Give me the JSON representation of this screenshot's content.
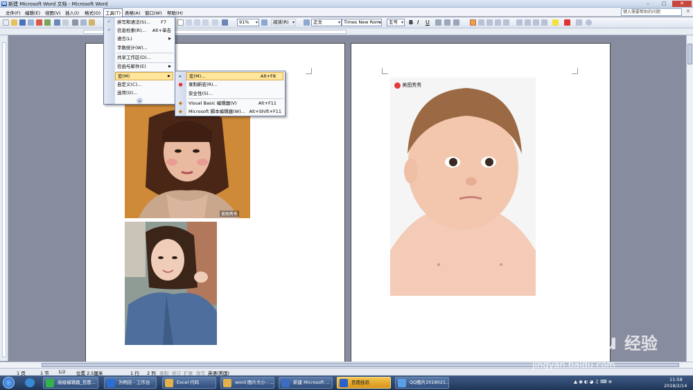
{
  "window": {
    "title": "新建 Microsoft Word 文档 - Microsoft Word"
  },
  "menubar": {
    "items": [
      "文件(F)",
      "编辑(E)",
      "视图(V)",
      "插入(I)",
      "格式(O)",
      "工具(T)",
      "表格(A)",
      "窗口(W)",
      "帮助(H)"
    ],
    "help_placeholder": "键入需要帮助的问题",
    "close_doc": "×"
  },
  "toolbar": {
    "zoom": "91%",
    "read_label": "阅读(R)",
    "style": "正文",
    "font": "Times New Roman",
    "size": "五号",
    "bold": "B",
    "italic": "I",
    "underline": "U"
  },
  "tools_menu": {
    "items": [
      {
        "label": "拼写和语法(S)...",
        "shortcut": "F7"
      },
      {
        "label": "信息检索(R)...",
        "shortcut": "Alt+单击"
      },
      {
        "label": "语言(L)",
        "shortcut": ""
      },
      {
        "label": "字数统计(W)...",
        "shortcut": ""
      },
      {
        "label": "共享工作区(D)...",
        "shortcut": ""
      },
      {
        "label": "信函与邮件(E)",
        "shortcut": ""
      },
      {
        "label": "宏(M)",
        "shortcut": ""
      },
      {
        "label": "自定义(C)...",
        "shortcut": ""
      },
      {
        "label": "选项(O)...",
        "shortcut": ""
      }
    ],
    "expand": "⌄"
  },
  "macro_submenu": {
    "items": [
      {
        "label": "宏(M)...",
        "shortcut": "Alt+F8"
      },
      {
        "label": "录制新宏(R)...",
        "shortcut": ""
      },
      {
        "label": "安全性(S)...",
        "shortcut": ""
      },
      {
        "label": "Visual Basic 编辑器(V)",
        "shortcut": "Alt+F11"
      },
      {
        "label": "Microsoft 脚本编辑器(W)...",
        "shortcut": "Alt+Shift+F11"
      }
    ]
  },
  "document": {
    "watermark_small": "美图秀秀",
    "watermark_right": "美图秀秀"
  },
  "statusbar": {
    "page": "1 页",
    "section": "1 节",
    "page_of": "1/2",
    "position": "位置 2.5厘米",
    "line": "1 行",
    "col": "2 列",
    "rec": "录制",
    "trk": "修订",
    "ext": "扩展",
    "ovr": "改写",
    "lang": "英语(美国)"
  },
  "taskbar": {
    "items": [
      "高级编辑器_百度...",
      "为明店 - 工作台",
      "Excel 代码",
      "word 图片大小 - ...",
      "新建 Microsoft ...",
      "百度经验",
      "QQ图片2018021..."
    ],
    "time": "11:58",
    "date": "2018/2/14"
  },
  "watermark": {
    "brand": "Bai",
    "brand2": "du",
    "jingyan": "经验",
    "url": "jingyan.baidu.com"
  }
}
